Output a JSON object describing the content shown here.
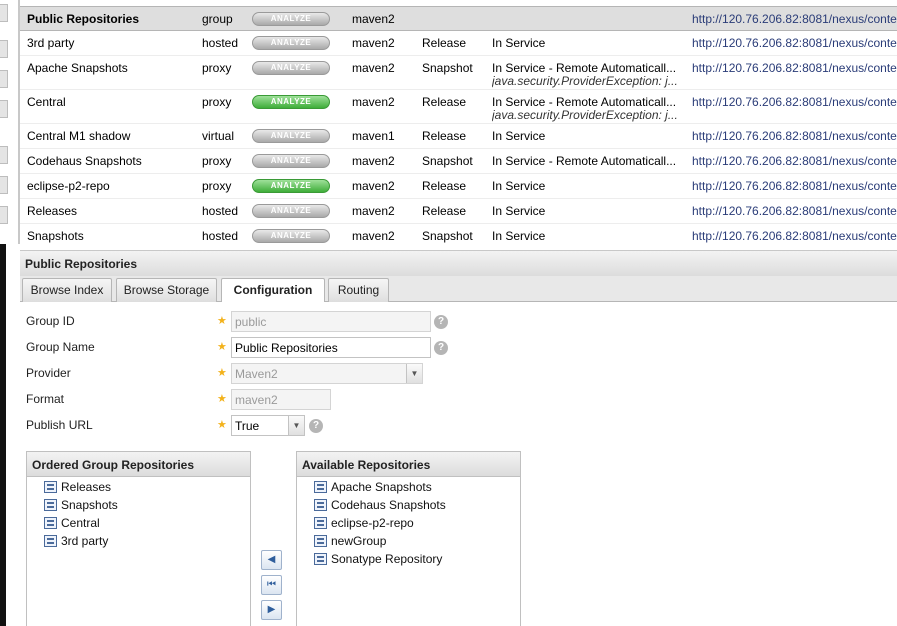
{
  "repositories": [
    {
      "name": "Public Repositories",
      "type": "group",
      "analyze": "ANALYZE",
      "analyze_active": false,
      "format": "maven2",
      "policy": "",
      "status": "",
      "status_detail": "",
      "url": "http://120.76.206.82:8081/nexus/conte",
      "selected": true
    },
    {
      "name": "3rd party",
      "type": "hosted",
      "analyze": "ANALYZE",
      "analyze_active": false,
      "format": "maven2",
      "policy": "Release",
      "status": "In Service",
      "status_detail": "",
      "url": "http://120.76.206.82:8081/nexus/conte",
      "selected": false
    },
    {
      "name": "Apache Snapshots",
      "type": "proxy",
      "analyze": "ANALYZE",
      "analyze_active": false,
      "format": "maven2",
      "policy": "Snapshot",
      "status": "In Service - Remote Automaticall...",
      "status_detail": "java.security.ProviderException: j...",
      "url": "http://120.76.206.82:8081/nexus/conte",
      "selected": false
    },
    {
      "name": "Central",
      "type": "proxy",
      "analyze": "ANALYZE",
      "analyze_active": true,
      "format": "maven2",
      "policy": "Release",
      "status": "In Service - Remote Automaticall...",
      "status_detail": "java.security.ProviderException: j...",
      "url": "http://120.76.206.82:8081/nexus/conte",
      "selected": false
    },
    {
      "name": "Central M1 shadow",
      "type": "virtual",
      "analyze": "ANALYZE",
      "analyze_active": false,
      "format": "maven1",
      "policy": "Release",
      "status": "In Service",
      "status_detail": "",
      "url": "http://120.76.206.82:8081/nexus/conte",
      "selected": false
    },
    {
      "name": "Codehaus Snapshots",
      "type": "proxy",
      "analyze": "ANALYZE",
      "analyze_active": false,
      "format": "maven2",
      "policy": "Snapshot",
      "status": "In Service - Remote Automaticall...",
      "status_detail": "",
      "url": "http://120.76.206.82:8081/nexus/conte",
      "selected": false
    },
    {
      "name": "eclipse-p2-repo",
      "type": "proxy",
      "analyze": "ANALYZE",
      "analyze_active": true,
      "format": "maven2",
      "policy": "Release",
      "status": "In Service",
      "status_detail": "",
      "url": "http://120.76.206.82:8081/nexus/conte",
      "selected": false
    },
    {
      "name": "Releases",
      "type": "hosted",
      "analyze": "ANALYZE",
      "analyze_active": false,
      "format": "maven2",
      "policy": "Release",
      "status": "In Service",
      "status_detail": "",
      "url": "http://120.76.206.82:8081/nexus/conte",
      "selected": false
    },
    {
      "name": "Snapshots",
      "type": "hosted",
      "analyze": "ANALYZE",
      "analyze_active": false,
      "format": "maven2",
      "policy": "Snapshot",
      "status": "In Service",
      "status_detail": "",
      "url": "http://120.76.206.82:8081/nexus/conte",
      "selected": false
    }
  ],
  "panel": {
    "title": "Public Repositories",
    "tabs": [
      {
        "label": "Browse Index",
        "active": false
      },
      {
        "label": "Browse Storage",
        "active": false
      },
      {
        "label": "Configuration",
        "active": true
      },
      {
        "label": "Routing",
        "active": false
      }
    ]
  },
  "form": {
    "group_id": {
      "label": "Group ID",
      "value": "public"
    },
    "group_name": {
      "label": "Group Name",
      "value": "Public Repositories"
    },
    "provider": {
      "label": "Provider",
      "value": "Maven2"
    },
    "format": {
      "label": "Format",
      "value": "maven2"
    },
    "publish_url": {
      "label": "Publish URL",
      "value": "True"
    },
    "required_mark": "★",
    "help_mark": "?"
  },
  "ordered_group": {
    "title": "Ordered Group Repositories",
    "items": [
      "Releases",
      "Snapshots",
      "Central",
      "3rd party"
    ]
  },
  "available": {
    "title": "Available Repositories",
    "items": [
      "Apache Snapshots",
      "Codehaus Snapshots",
      "eclipse-p2-repo",
      "newGroup",
      "Sonatype Repository"
    ]
  },
  "move_buttons": {
    "left": "◀",
    "first": "⏮",
    "right": "▶"
  }
}
